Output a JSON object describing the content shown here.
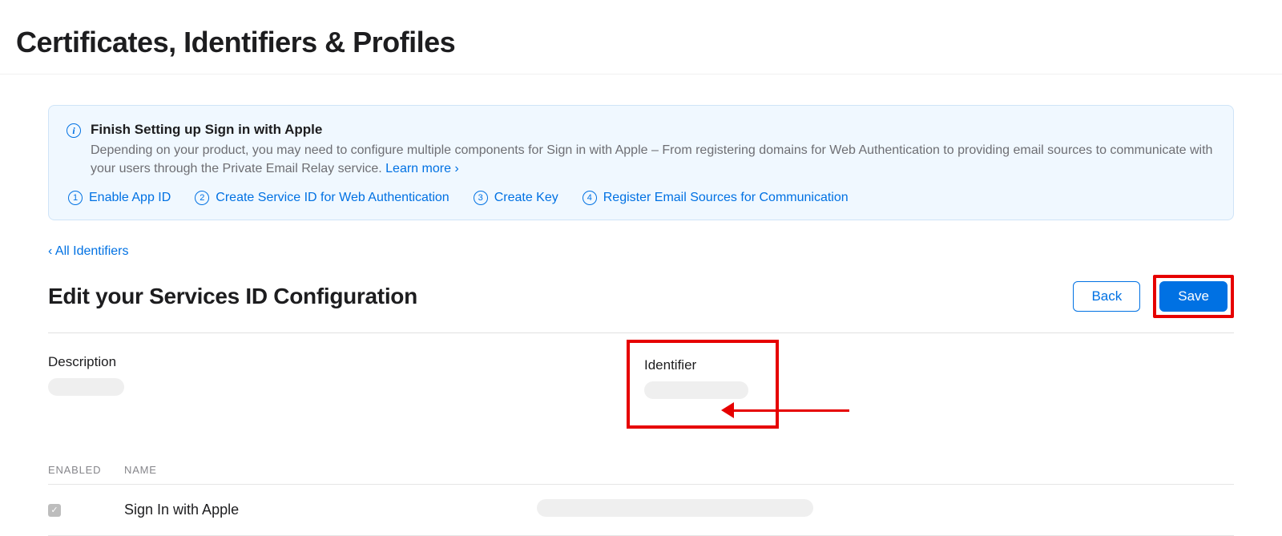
{
  "page_title": "Certificates, Identifiers & Profiles",
  "info": {
    "title": "Finish Setting up Sign in with Apple",
    "description_pre": "Depending on your product, you may need to configure multiple components for Sign in with Apple – From registering domains for Web Authentication to providing email sources to communicate with your users through the Private Email Relay service. ",
    "learn_more": "Learn more ›",
    "steps": [
      {
        "num": "1",
        "label": "Enable App ID"
      },
      {
        "num": "2",
        "label": "Create Service ID for Web Authentication"
      },
      {
        "num": "3",
        "label": "Create Key"
      },
      {
        "num": "4",
        "label": "Register Email Sources for Communication"
      }
    ]
  },
  "back_link": "‹ All Identifiers",
  "sub_title": "Edit your Services ID Configuration",
  "buttons": {
    "back": "Back",
    "save": "Save"
  },
  "detail": {
    "description_label": "Description",
    "identifier_label": "Identifier"
  },
  "table": {
    "head_enabled": "ENABLED",
    "head_name": "NAME",
    "row_name": "Sign In with Apple",
    "row_checked": true
  }
}
